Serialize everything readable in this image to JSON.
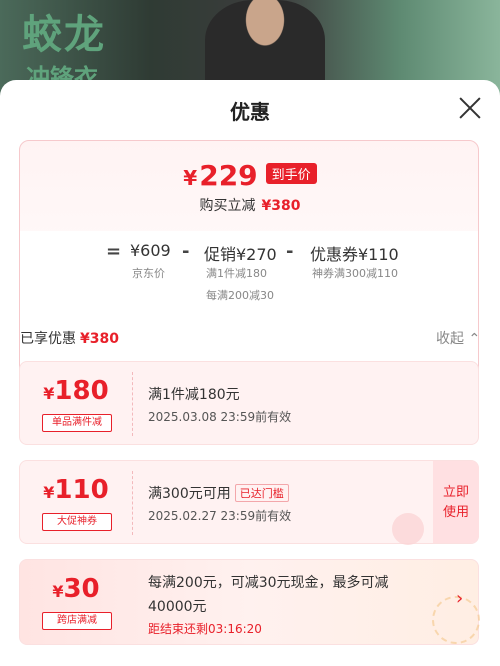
{
  "banner": {
    "line1": "蛟龙",
    "line2": "冲锋衣"
  },
  "sheet": {
    "title": "优惠"
  },
  "price": {
    "currency": "¥",
    "final_amount": "229",
    "tag": "到手价",
    "purchase_line": "购买立减",
    "purchase_amount": "¥380"
  },
  "breakdown": {
    "equals": "=",
    "jd_price": "¥609",
    "jd_caption": "京东价",
    "minus1": "-",
    "promo": "促销¥270",
    "promo_caption1": "满1件减180",
    "promo_caption2": "每满200减30",
    "minus2": "-",
    "coupon": "优惠券¥110",
    "coupon_caption": "神券满300减110"
  },
  "section": {
    "label": "已享优惠",
    "amount": "¥380",
    "collapse": "收起"
  },
  "coupons": [
    {
      "currency": "¥",
      "amount": "180",
      "badge": "单品满件减",
      "title": "满1件减180元",
      "date": "2025.03.08  23:59前有效"
    },
    {
      "currency": "¥",
      "amount": "110",
      "badge": "大促神券",
      "title": "满300元可用",
      "reached": "已达门槛",
      "date": "2025.02.27  23:59前有效",
      "use1": "立即",
      "use2": "使用"
    },
    {
      "currency": "¥",
      "amount": "30",
      "badge": "跨店满减",
      "title_line1": "每满200元，可减30元现金，最多可减",
      "title_line2": "40000元",
      "countdown": "距结束还剩03:16:20",
      "chevron": "›"
    }
  ],
  "colors": {
    "accent": "#e8202a"
  }
}
